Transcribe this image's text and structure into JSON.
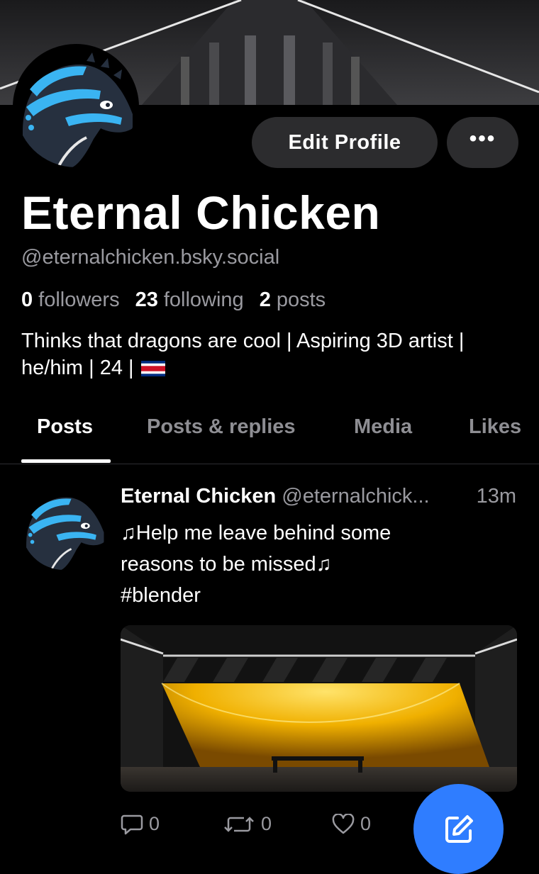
{
  "profile": {
    "display_name": "Eternal Chicken",
    "handle": "@eternalchicken.bsky.social",
    "followers_count": "0",
    "followers_label": "followers",
    "following_count": "23",
    "following_label": "following",
    "posts_count": "2",
    "posts_label": "posts",
    "bio": "Thinks that dragons are cool | Aspiring 3D artist | he/him | 24 |",
    "bio_flag": "costa-rica-flag"
  },
  "header": {
    "edit_profile_label": "Edit Profile",
    "more_label": "•••"
  },
  "tabs": [
    {
      "label": "Posts",
      "active": true
    },
    {
      "label": "Posts & replies",
      "active": false
    },
    {
      "label": "Media",
      "active": false
    },
    {
      "label": "Likes",
      "active": false
    }
  ],
  "post": {
    "author_name": "Eternal Chicken",
    "author_handle": "@eternalchick...",
    "time": "13m",
    "text_line1": "♫Help me leave behind some",
    "text_line2": "reasons to be missed♫",
    "text_line3": "#blender",
    "reply_count": "0",
    "repost_count": "0",
    "like_count": "0"
  },
  "colors": {
    "accent": "#2f7dff",
    "muted": "#9a9aa0",
    "button_bg": "#2c2c2e",
    "dragon_blue": "#3ab4f2"
  },
  "icons": {
    "reply": "comment-icon",
    "repost": "repost-icon",
    "like": "heart-icon",
    "compose": "compose-icon",
    "more": "ellipsis-icon"
  }
}
